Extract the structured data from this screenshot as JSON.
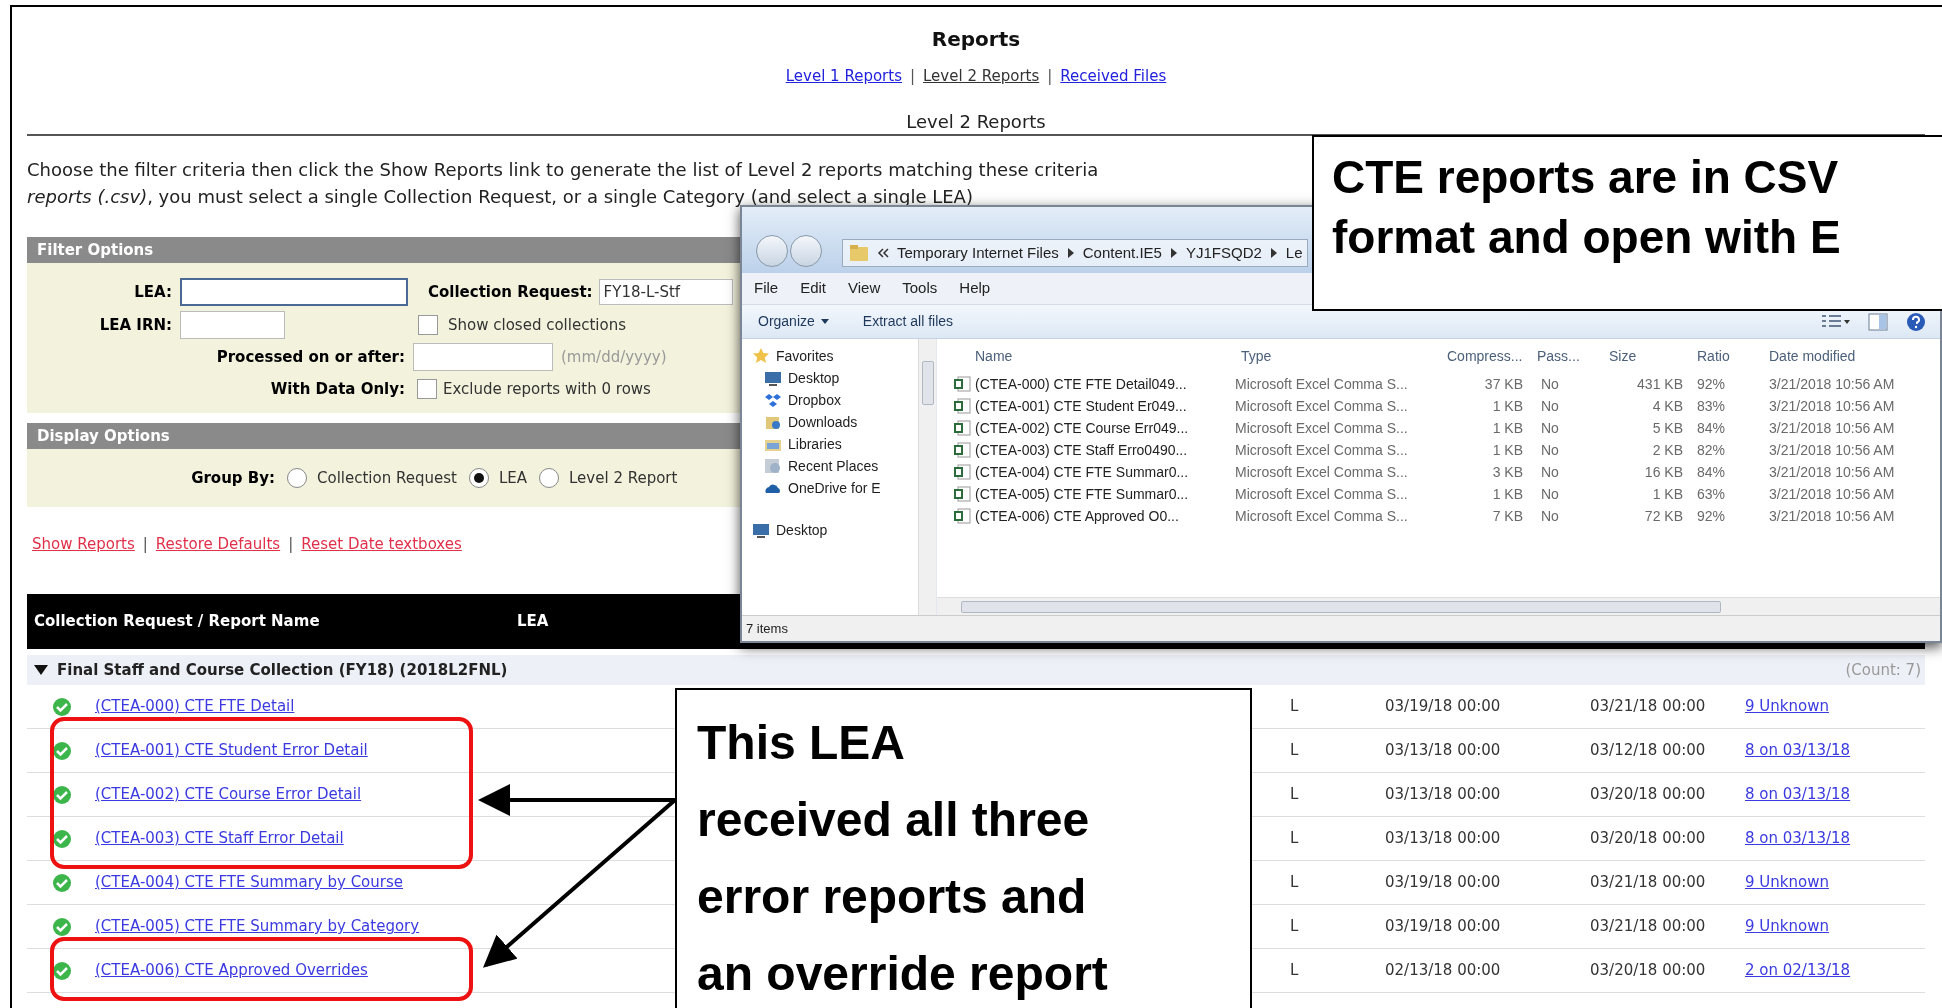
{
  "page": {
    "title": "Reports",
    "nav": [
      {
        "label": "Level 1 Reports",
        "selected": false
      },
      {
        "label": "Level 2 Reports",
        "selected": true
      },
      {
        "label": "Received Files",
        "selected": false
      }
    ],
    "nav_separators": [
      "|",
      "|"
    ],
    "subtitle": "Level 2 Reports",
    "intro": [
      "Choose the filter criteria then click the Show Reports link to generate the list of Level 2 reports matching these criteria",
      "*reports (.csv)*, you must select a single Collection Request, or a single Category (and select a single LEA)"
    ]
  },
  "filter_options": {
    "title": "Filter Options",
    "lea": {
      "label": "LEA:",
      "focused": true
    },
    "lea_irn": {
      "label": "LEA IRN:"
    },
    "collection_request": {
      "label": "Collection Request:",
      "value": "FY18-L-Stf"
    },
    "show_closed": {
      "label": "Show closed collections",
      "checked": false
    },
    "processed": {
      "label": "Processed on or after:",
      "hint": "(mm/dd/yyyy)"
    },
    "with_data": {
      "label": "With Data Only:"
    },
    "exclude_zero": {
      "label": "Exclude reports with 0 rows",
      "checked": false
    }
  },
  "display_options": {
    "title": "Display Options",
    "group_by_label": "Group By:",
    "options": [
      {
        "label": "Collection Request",
        "selected": false
      },
      {
        "label": "LEA",
        "selected": true
      },
      {
        "label": "Level 2 Report",
        "selected": false
      }
    ]
  },
  "actions": [
    "Show Reports",
    "Restore Defaults",
    "Reset Date textboxes"
  ],
  "action_separators": [
    "|",
    "|"
  ],
  "table": {
    "columns": [
      "Collection Request / Report Name",
      "LEA"
    ],
    "group": {
      "label": "Final Staff and Course Collection (FY18) (2018L2FNL)",
      "expanded": true,
      "count": "(Count: 7)"
    },
    "rows": [
      {
        "name": "(CTEA-000) CTE FTE Detail",
        "column_3": "L",
        "column_4": "03/19/18 00:00",
        "column_5": "03/21/18 00:00",
        "column_6": "9 Unknown",
        "highlighted": false
      },
      {
        "name": "(CTEA-001) CTE Student Error Detail",
        "column_3": "L",
        "column_4": "03/13/18 00:00",
        "column_5": "03/12/18 00:00",
        "column_6": "8 on 03/13/18",
        "highlighted": true
      },
      {
        "name": "(CTEA-002) CTE Course Error Detail",
        "column_3": "L",
        "column_4": "03/13/18 00:00",
        "column_5": "03/20/18 00:00",
        "column_6": "8 on 03/13/18",
        "highlighted": true
      },
      {
        "name": "(CTEA-003) CTE Staff Error Detail",
        "column_3": "L",
        "column_4": "03/13/18 00:00",
        "column_5": "03/20/18 00:00",
        "column_6": "8 on 03/13/18",
        "highlighted": true
      },
      {
        "name": "(CTEA-004) CTE FTE Summary by Course",
        "column_3": "L",
        "column_4": "03/19/18 00:00",
        "column_5": "03/21/18 00:00",
        "column_6": "9 Unknown",
        "highlighted": false
      },
      {
        "name": "(CTEA-005) CTE FTE Summary by Category",
        "column_3": "L",
        "column_4": "03/19/18 00:00",
        "column_5": "03/21/18 00:00",
        "column_6": "9 Unknown",
        "highlighted": false
      },
      {
        "name": "(CTEA-006) CTE Approved Overrides",
        "column_3": "L",
        "column_4": "02/13/18 00:00",
        "column_5": "03/20/18 00:00",
        "column_6": "2 on 02/13/18",
        "highlighted": true
      }
    ]
  },
  "explorer": {
    "breadcrumb": [
      "Temporary Internet Files",
      "Content.IE5",
      "YJ1FSQD2",
      "Le"
    ],
    "menu": [
      "File",
      "Edit",
      "View",
      "Tools",
      "Help"
    ],
    "toolbar": [
      {
        "label": "Organize",
        "kind": "dropdown"
      },
      {
        "label": "Extract all files",
        "kind": "button"
      }
    ],
    "nav_pane": [
      {
        "label": "Favorites",
        "kind": "favorites"
      },
      {
        "label": "Desktop",
        "kind": "desktop"
      },
      {
        "label": "Dropbox",
        "kind": "dropbox"
      },
      {
        "label": "Downloads",
        "kind": "downloads"
      },
      {
        "label": "Libraries",
        "kind": "libraries"
      },
      {
        "label": "Recent Places",
        "kind": "recent"
      },
      {
        "label": "OneDrive for E",
        "kind": "onedrive"
      },
      {
        "label": "Desktop",
        "kind": "root"
      }
    ],
    "columns": [
      "Name",
      "Type",
      "Compress...",
      "Pass...",
      "Size",
      "Ratio",
      "Date modified"
    ],
    "rows": [
      [
        "(CTEA-000) CTE FTE Detail049...",
        "Microsoft Excel Comma S...",
        "37 KB",
        "No",
        "431 KB",
        "92%",
        "3/21/2018 10:56 AM"
      ],
      [
        "(CTEA-001) CTE Student Er049...",
        "Microsoft Excel Comma S...",
        "1 KB",
        "No",
        "4 KB",
        "83%",
        "3/21/2018 10:56 AM"
      ],
      [
        "(CTEA-002) CTE Course Err049...",
        "Microsoft Excel Comma S...",
        "1 KB",
        "No",
        "5 KB",
        "84%",
        "3/21/2018 10:56 AM"
      ],
      [
        "(CTEA-003) CTE Staff Erro0490...",
        "Microsoft Excel Comma S...",
        "1 KB",
        "No",
        "2 KB",
        "82%",
        "3/21/2018 10:56 AM"
      ],
      [
        "(CTEA-004) CTE FTE Summar0...",
        "Microsoft Excel Comma S...",
        "3 KB",
        "No",
        "16 KB",
        "84%",
        "3/21/2018 10:56 AM"
      ],
      [
        "(CTEA-005) CTE FTE Summar0...",
        "Microsoft Excel Comma S...",
        "1 KB",
        "No",
        "1 KB",
        "63%",
        "3/21/2018 10:56 AM"
      ],
      [
        "(CTEA-006) CTE Approved O0...",
        "Microsoft Excel Comma S...",
        "7 KB",
        "No",
        "72 KB",
        "92%",
        "3/21/2018 10:56 AM"
      ]
    ],
    "status": "7 items"
  },
  "callouts": [
    {
      "lines": [
        "CTE reports are in CSV",
        "format and open with E"
      ]
    },
    {
      "lines": [
        "This LEA",
        "received all three",
        "error reports and",
        "an override report"
      ]
    }
  ]
}
